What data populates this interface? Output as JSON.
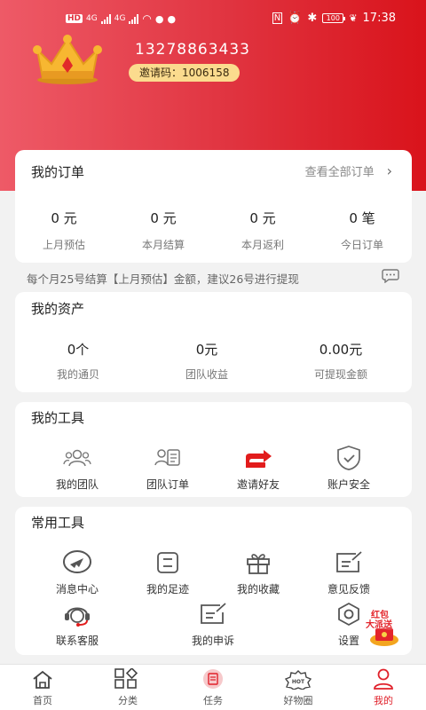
{
  "status_bar": {
    "left_text": "HD",
    "network_a": "4G",
    "network_b": "4G",
    "battery": "100",
    "time": "17:38"
  },
  "profile": {
    "phone": "13278863433",
    "invite_label": "邀请码：",
    "invite_code": "1006158"
  },
  "orders": {
    "title": "我的订单",
    "view_all": "查看全部订单",
    "stats": [
      {
        "value": "0 元",
        "label": "上月预估"
      },
      {
        "value": "0 元",
        "label": "本月结算"
      },
      {
        "value": "0 元",
        "label": "本月返利"
      },
      {
        "value": "0 笔",
        "label": "今日订单"
      }
    ]
  },
  "notice": "每个月25号结算【上月预估】金额，建议26号进行提现",
  "assets": {
    "title": "我的资产",
    "stats": [
      {
        "value": "0个",
        "label": "我的通贝"
      },
      {
        "value": "0元",
        "label": "团队收益"
      },
      {
        "value": "0.00元",
        "label": "可提现金额"
      }
    ]
  },
  "my_tools": {
    "title": "我的工具",
    "items": [
      {
        "label": "我的团队",
        "icon": "team-icon"
      },
      {
        "label": "团队订单",
        "icon": "team-order-icon"
      },
      {
        "label": "邀请好友",
        "icon": "invite-friend-icon"
      },
      {
        "label": "账户安全",
        "icon": "shield-check-icon"
      }
    ]
  },
  "common_tools": {
    "title": "常用工具",
    "items": [
      {
        "label": "消息中心",
        "icon": "message-icon"
      },
      {
        "label": "我的足迹",
        "icon": "footprint-icon"
      },
      {
        "label": "我的收藏",
        "icon": "gift-icon"
      },
      {
        "label": "意见反馈",
        "icon": "feedback-icon"
      },
      {
        "label": "联系客服",
        "icon": "customer-service-icon"
      },
      {
        "label": "我的申诉",
        "icon": "appeal-icon"
      },
      {
        "label": "设置",
        "icon": "settings-icon"
      }
    ]
  },
  "promo": {
    "line1": "红包",
    "line2": "大派送"
  },
  "tabbar": {
    "active_color": "#e0202a",
    "items": [
      {
        "label": "首页",
        "icon": "home-icon"
      },
      {
        "label": "分类",
        "icon": "category-icon"
      },
      {
        "label": "任务",
        "icon": "task-icon"
      },
      {
        "label": "好物圈",
        "icon": "hot-icon",
        "badge": "HOT"
      },
      {
        "label": "我的",
        "icon": "user-icon"
      }
    ]
  }
}
